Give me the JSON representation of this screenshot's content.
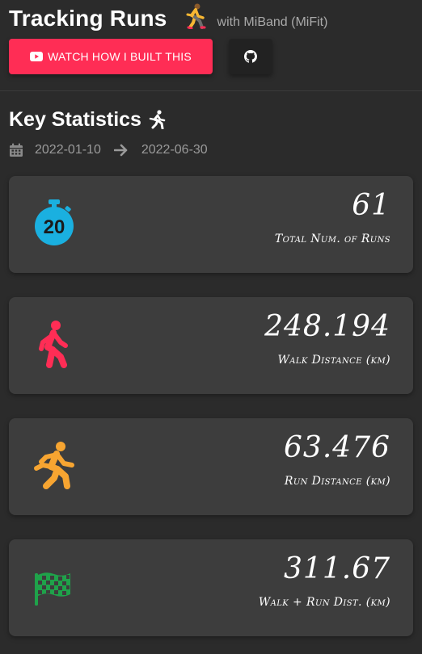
{
  "header": {
    "title": "Tracking Runs",
    "subtitle": "with MiBand (MiFit)"
  },
  "actions": {
    "watch_label": "WATCH HOW I BUILT THIS",
    "github_icon": "github-icon"
  },
  "colors": {
    "background": "#2b2b2b",
    "card": "#3d3d3d",
    "accent_red": "#ff2d55",
    "blue": "#1ab0e0",
    "orange": "#f7a531",
    "green": "#1fa24a"
  },
  "stats": {
    "title": "Key Statistics",
    "start_date": "2022-01-10",
    "end_date": "2022-06-30",
    "cards": [
      {
        "value": "61",
        "label": "Total Num. of Runs",
        "icon": "stopwatch-icon",
        "icon_text": "20"
      },
      {
        "value": "248.194",
        "label": "Walk Distance (km)",
        "icon": "walking-icon"
      },
      {
        "value": "63.476",
        "label": "Run Distance (km)",
        "icon": "running-icon"
      },
      {
        "value": "311.67",
        "label": "Walk + Run Dist. (km)",
        "icon": "checkered-flag-icon"
      }
    ]
  }
}
